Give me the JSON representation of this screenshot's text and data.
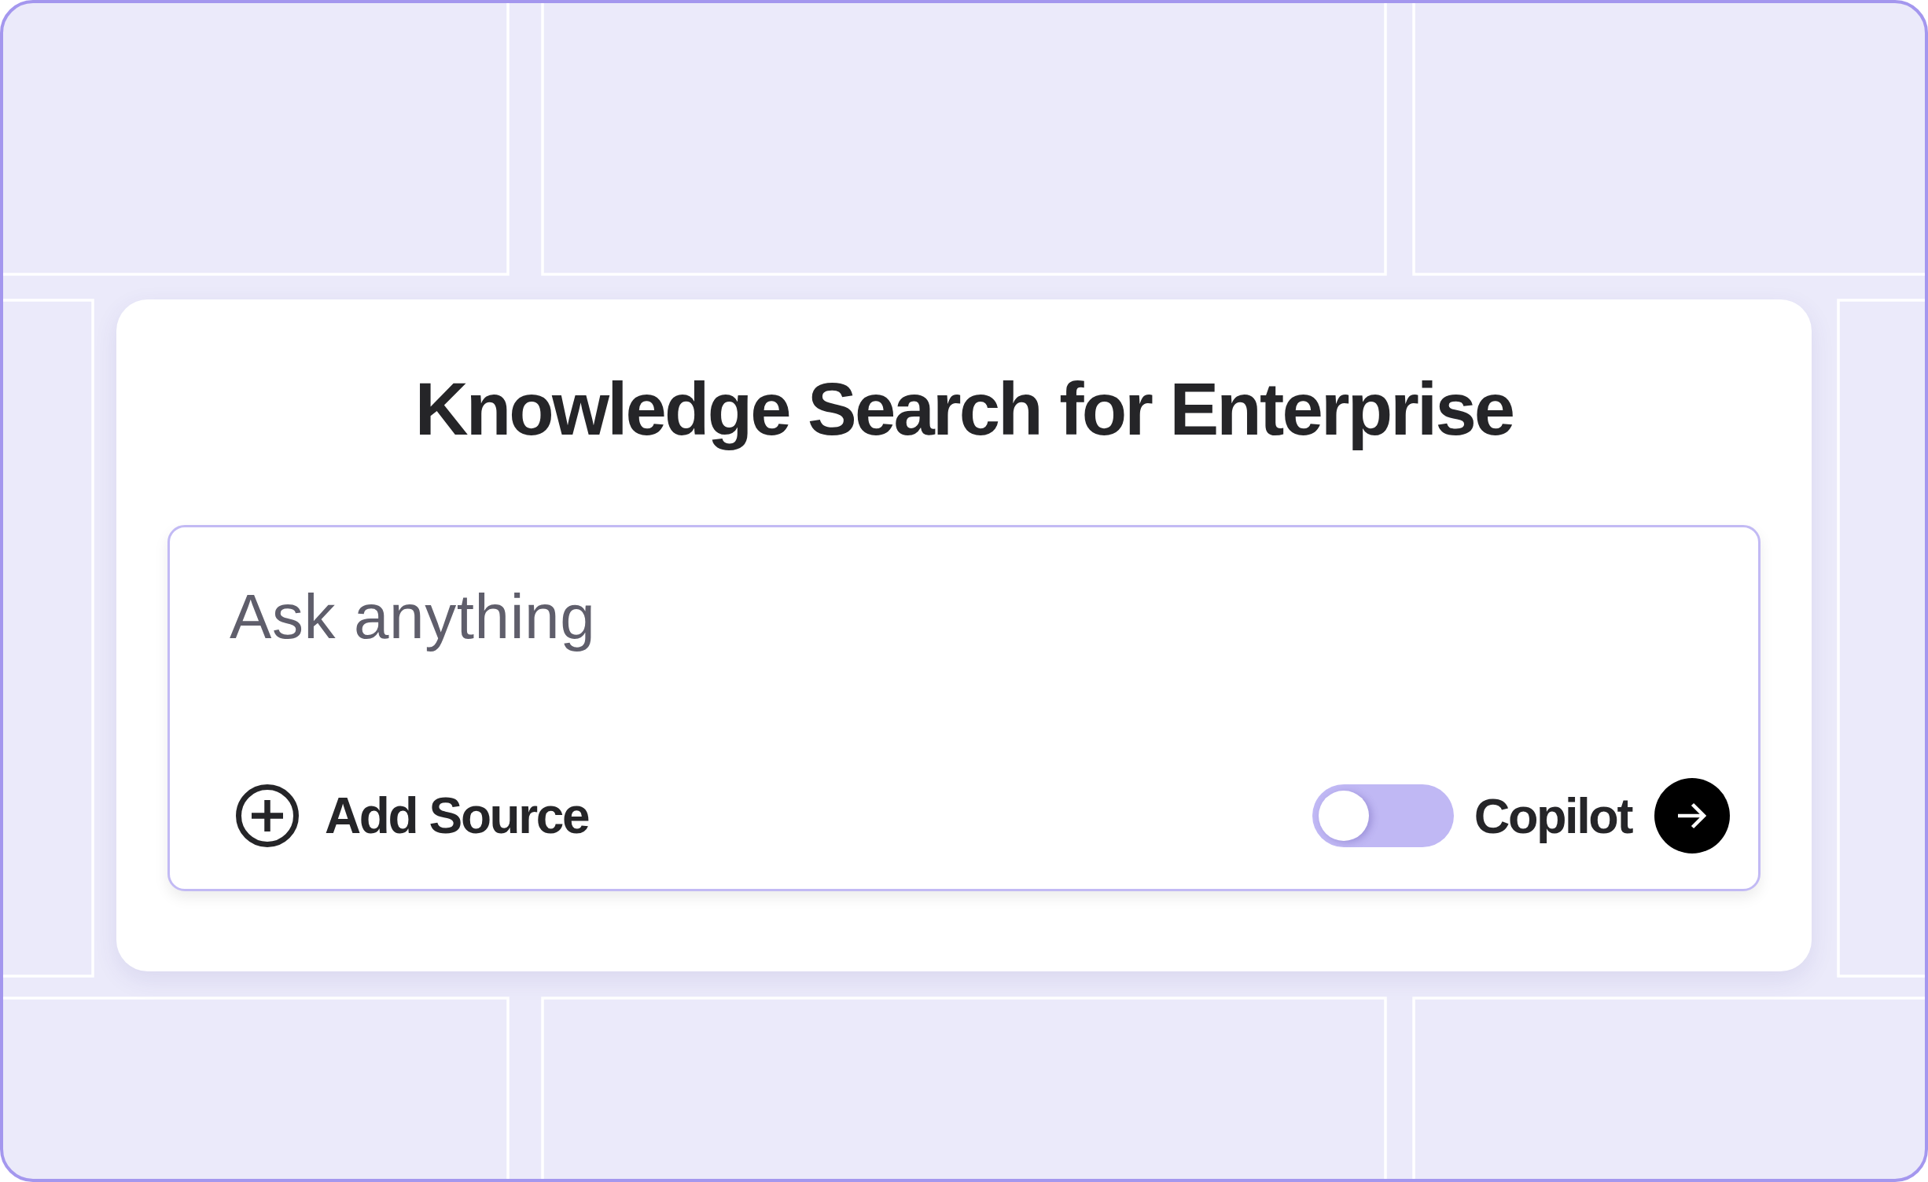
{
  "title": "Knowledge Search for Enterprise",
  "search": {
    "placeholder": "Ask anything"
  },
  "add_source": {
    "label": "Add Source"
  },
  "copilot": {
    "label": "Copilot",
    "on": false
  }
}
